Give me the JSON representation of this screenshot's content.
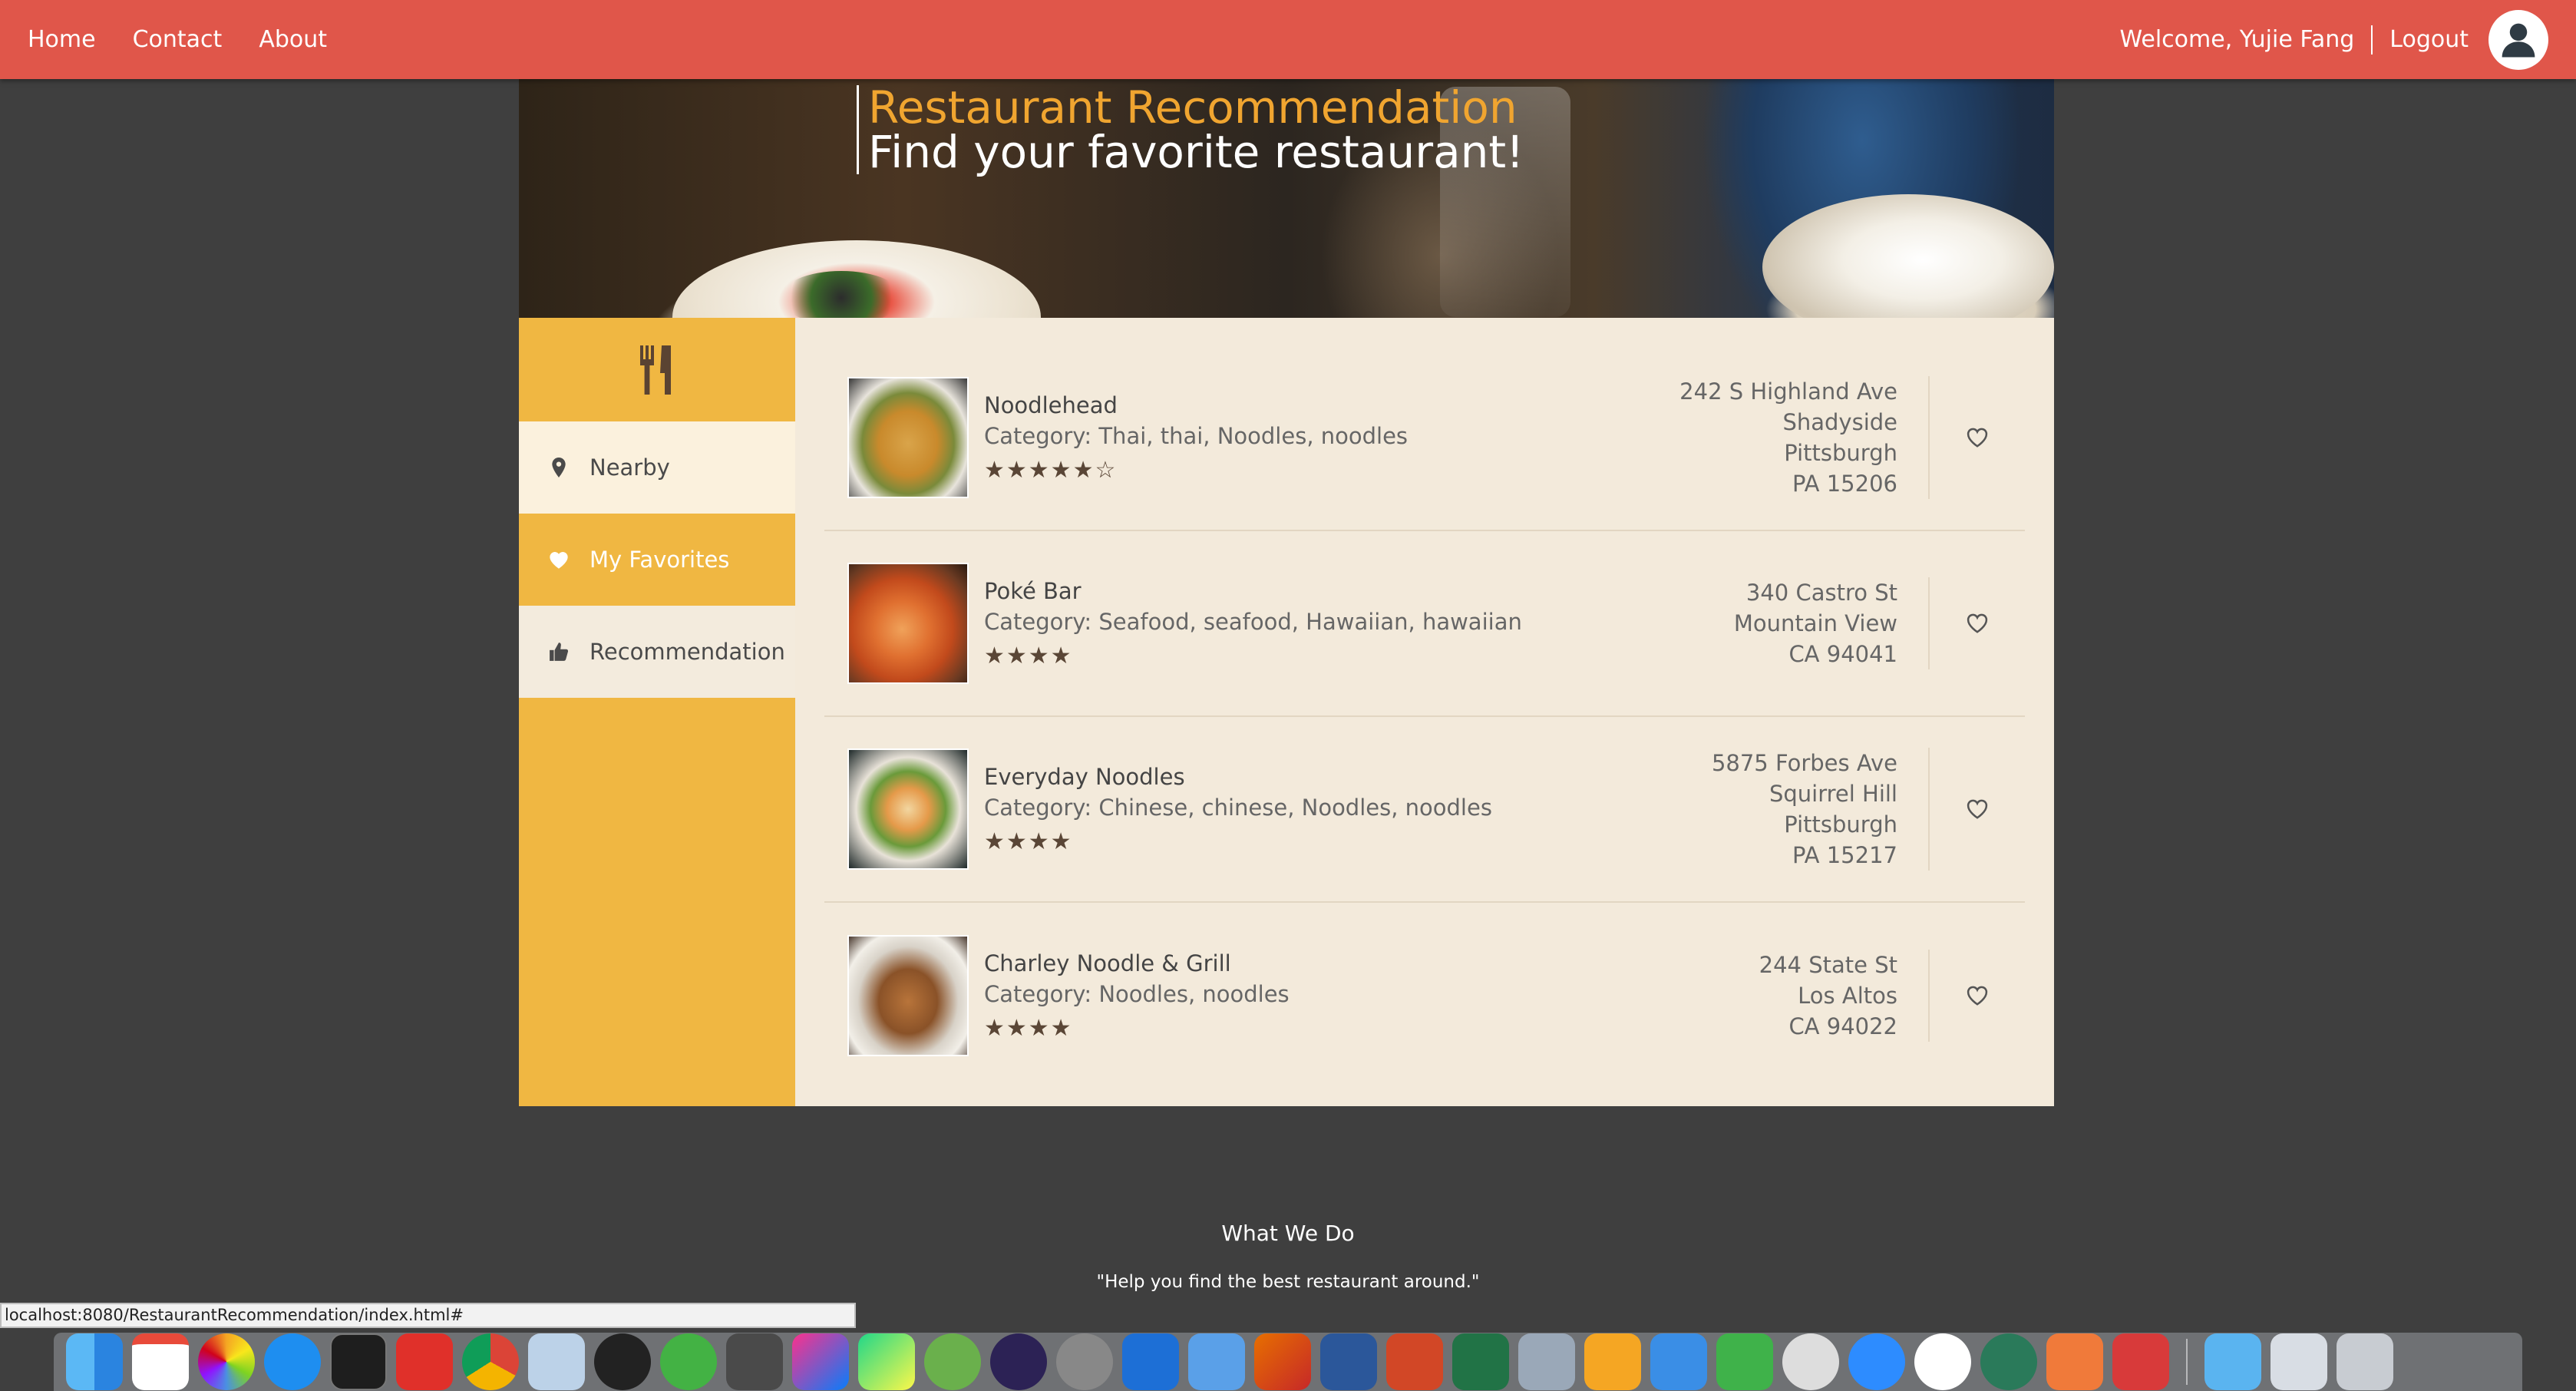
{
  "nav": {
    "links": [
      "Home",
      "Contact",
      "About"
    ],
    "welcome": "Welcome, Yujie Fang",
    "logout": "Logout"
  },
  "hero": {
    "title": "Restaurant Recommendation",
    "subtitle": "Find your favorite restaurant!"
  },
  "sidebar": {
    "items": [
      {
        "label": "Nearby",
        "icon": "map-pin-icon"
      },
      {
        "label": "My Favorites",
        "icon": "heart-icon"
      },
      {
        "label": "Recommendation",
        "icon": "thumbs-up-icon"
      }
    ]
  },
  "restaurants": [
    {
      "name": "Noodlehead",
      "category": "Category: Thai, thai, Noodles, noodles",
      "stars": "★★★★★☆",
      "rating": 4.5,
      "address": [
        "242 S Highland Ave",
        "Shadyside",
        "Pittsburgh",
        "PA 15206"
      ]
    },
    {
      "name": "Poké Bar",
      "category": "Category: Seafood, seafood, Hawaiian, hawaiian",
      "stars": "★★★★",
      "rating": 4,
      "address": [
        "340 Castro St",
        "Mountain View",
        "CA 94041"
      ]
    },
    {
      "name": "Everyday Noodles",
      "category": "Category: Chinese, chinese, Noodles, noodles",
      "stars": "★★★★",
      "rating": 4,
      "address": [
        "5875 Forbes Ave",
        "Squirrel Hill",
        "Pittsburgh",
        "PA 15217"
      ]
    },
    {
      "name": "Charley Noodle & Grill",
      "category": "Category: Noodles, noodles",
      "stars": "★★★★",
      "rating": 4,
      "address": [
        "244 State St",
        "Los Altos",
        "CA 94022"
      ]
    }
  ],
  "footer": {
    "title": "What We Do",
    "text": "\"Help you find the best restaurant around.\""
  },
  "status_url": "localhost:8080/RestaurantRecommendation/index.html#",
  "colors": {
    "navbar": "#e0564a",
    "sidebar": "#f0b742",
    "content_bg": "#f3eadb",
    "page_bg": "#3f3f3f",
    "title_accent": "#f0a530"
  }
}
